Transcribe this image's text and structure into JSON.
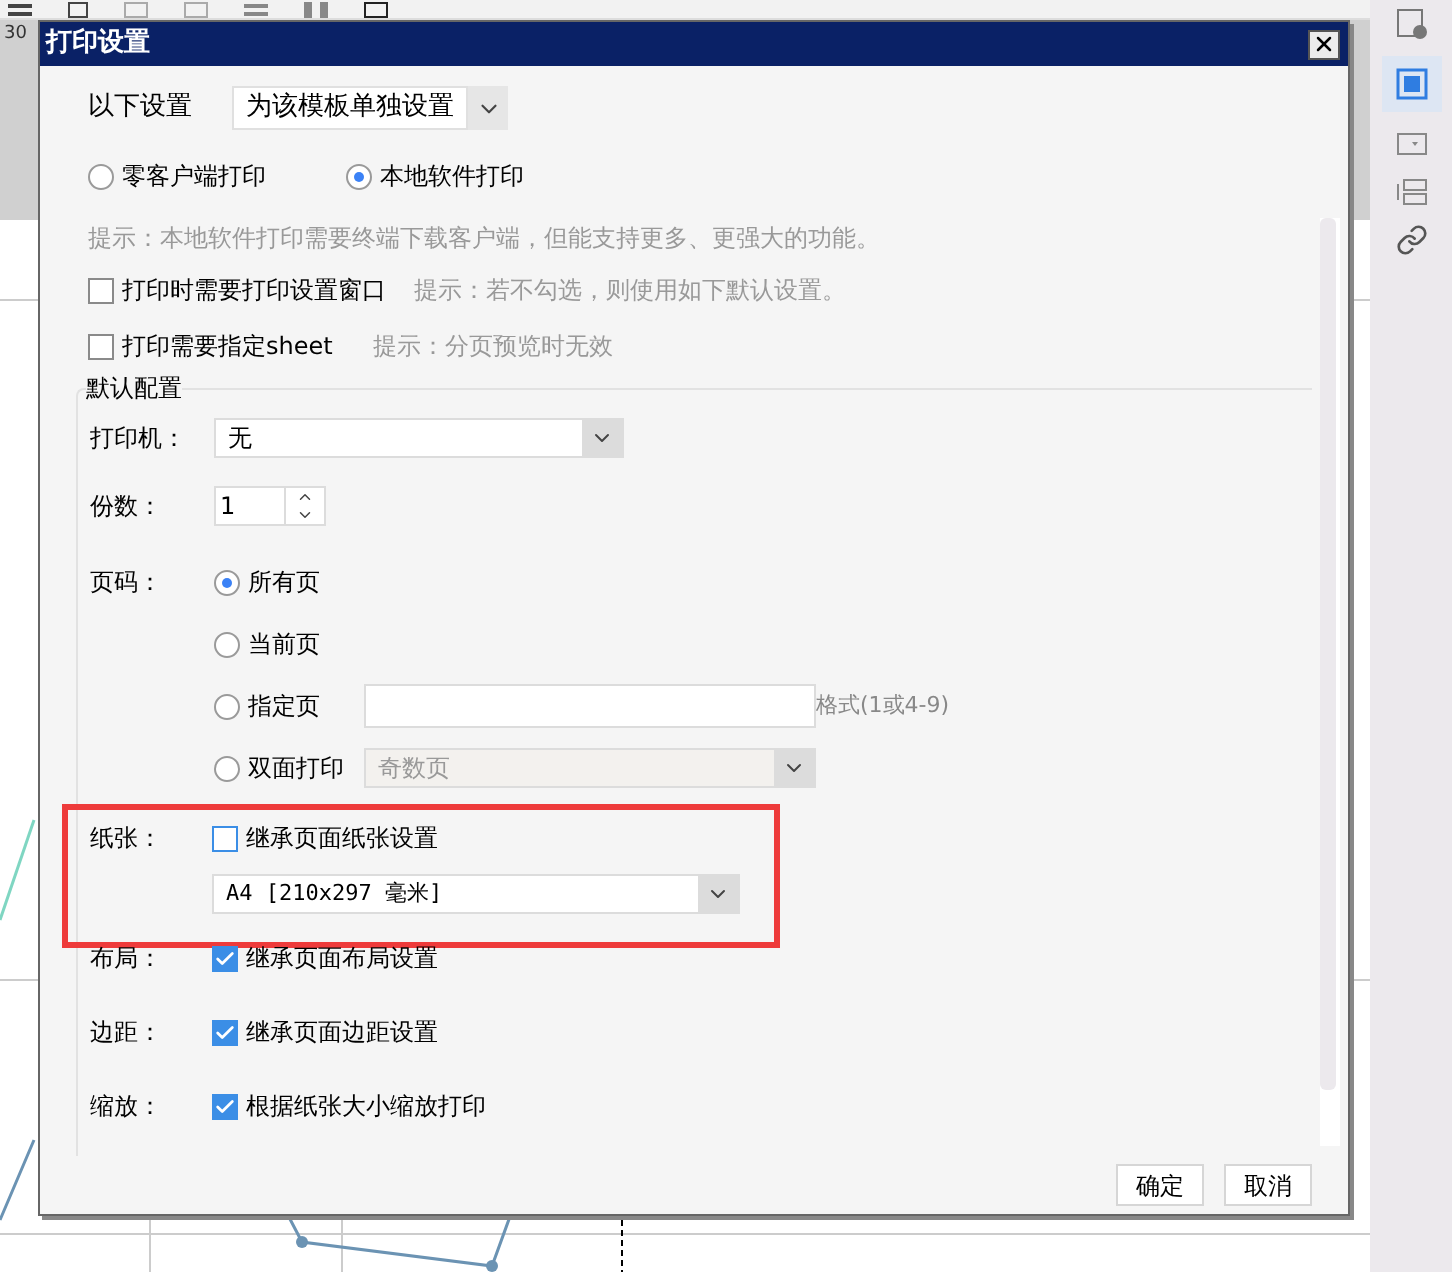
{
  "ruler_label": "30",
  "dialog": {
    "title": "打印设置",
    "scope": {
      "label": "以下设置",
      "value": "为该模板单独设置"
    },
    "print_modes": [
      {
        "label": "零客户端打印",
        "selected": false
      },
      {
        "label": "本地软件打印",
        "selected": true
      }
    ],
    "mode_hint": "提示：本地软件打印需要终端下载客户端，但能支持更多、更强大的功能。",
    "options": [
      {
        "label": "打印时需要打印设置窗口",
        "checked": false,
        "hint": "提示：若不勾选，则使用如下默认设置。"
      },
      {
        "label": "打印需要指定sheet",
        "checked": false,
        "hint": "提示：分页预览时无效"
      }
    ],
    "defaults": {
      "title": "默认配置",
      "printer": {
        "label": "打印机：",
        "value": "无"
      },
      "copies": {
        "label": "份数：",
        "value": "1"
      },
      "pages": {
        "label": "页码：",
        "choices": [
          {
            "kind": "plain",
            "label": "所有页",
            "selected": true
          },
          {
            "kind": "plain",
            "label": "当前页",
            "selected": false
          },
          {
            "kind": "input",
            "label": "指定页",
            "hint": "格式(1或4-9)",
            "selected": false
          },
          {
            "kind": "select",
            "label": "双面打印",
            "value": "奇数页",
            "disabled": true,
            "selected": false
          }
        ]
      },
      "settings": [
        {
          "label": "纸张：",
          "option": "继承页面纸张设置",
          "checked": false,
          "highlighted": true,
          "size": "A4 [210x297 毫米]"
        },
        {
          "label": "布局：",
          "option": "继承页面布局设置",
          "checked": true,
          "highlighted": false
        },
        {
          "label": "边距：",
          "option": "继承页面边距设置",
          "checked": true,
          "highlighted": false
        },
        {
          "label": "缩放：",
          "option": "根据纸张大小缩放打印",
          "checked": true,
          "highlighted": false
        }
      ]
    },
    "buttons": [
      "确定",
      "取消"
    ]
  }
}
